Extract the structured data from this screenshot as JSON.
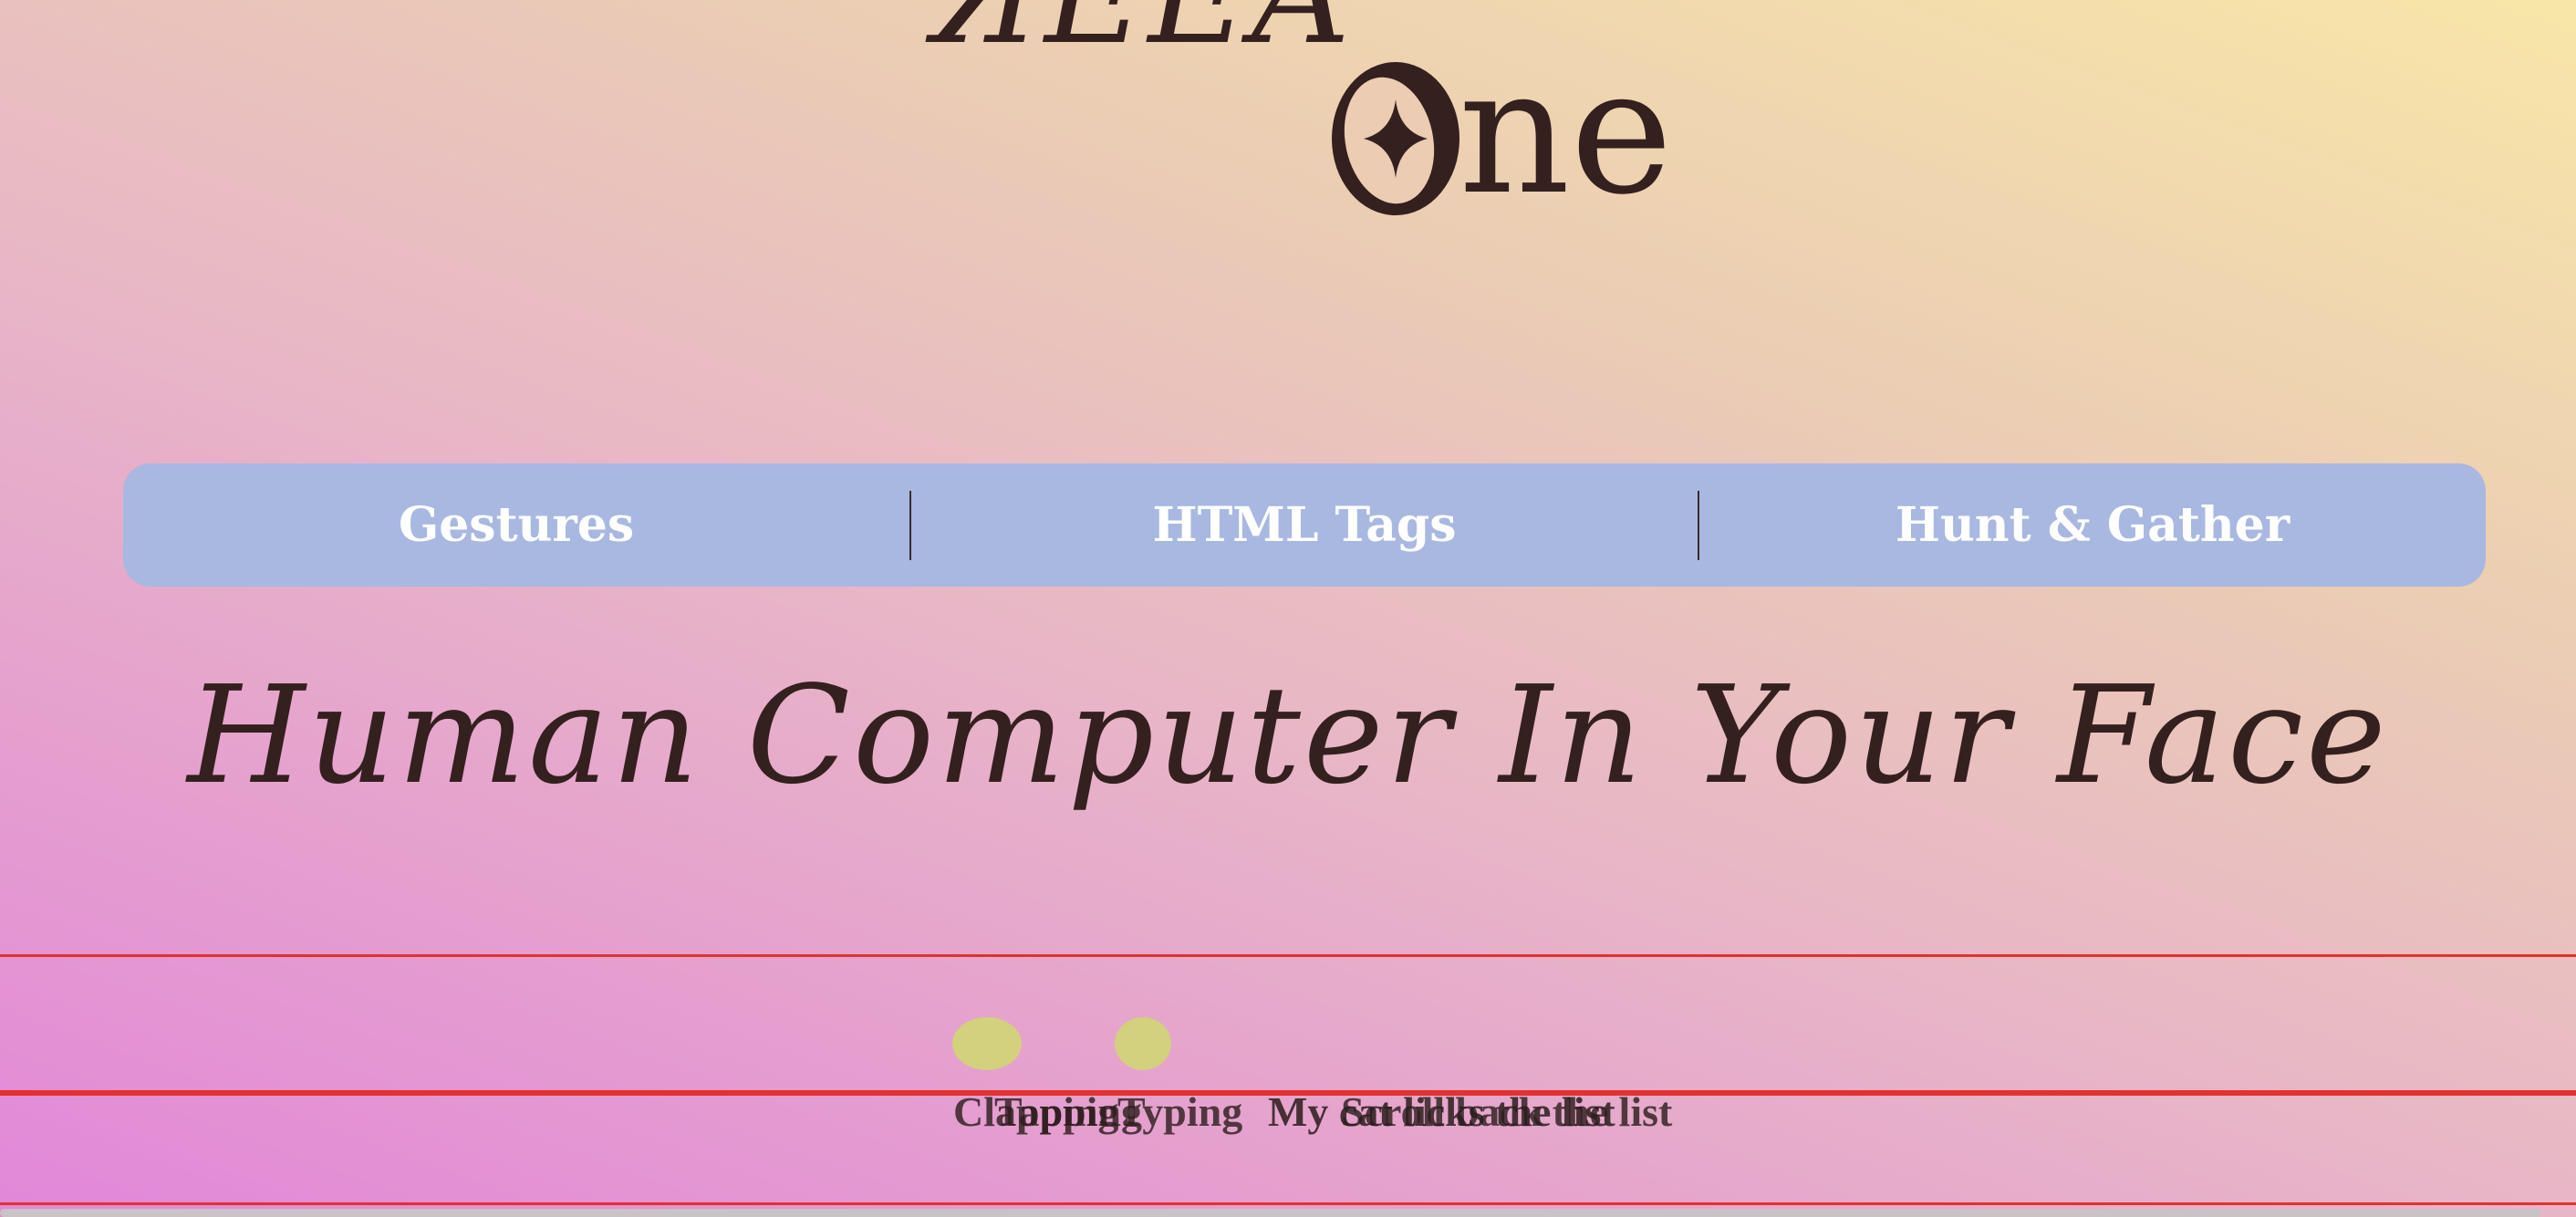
{
  "logo": {
    "partial_word": "ЯEEA",
    "one_text": "ne",
    "star_icon": "four-point-star-icon"
  },
  "nav": {
    "items": [
      {
        "label": "Gestures"
      },
      {
        "label": "HTML Tags"
      },
      {
        "label": "Hunt & Gather"
      }
    ]
  },
  "headline": "Human Computer In Your Face",
  "overlapping_labels": [
    "Clapping",
    "Tapping",
    "Typing",
    "My cat licks the list",
    "Scroll back the list"
  ],
  "colors": {
    "accent_red": "#e2312f",
    "dot_color": "#d3d07e",
    "nav_bg": "#a8b8e1",
    "text_dark": "#34201f"
  }
}
